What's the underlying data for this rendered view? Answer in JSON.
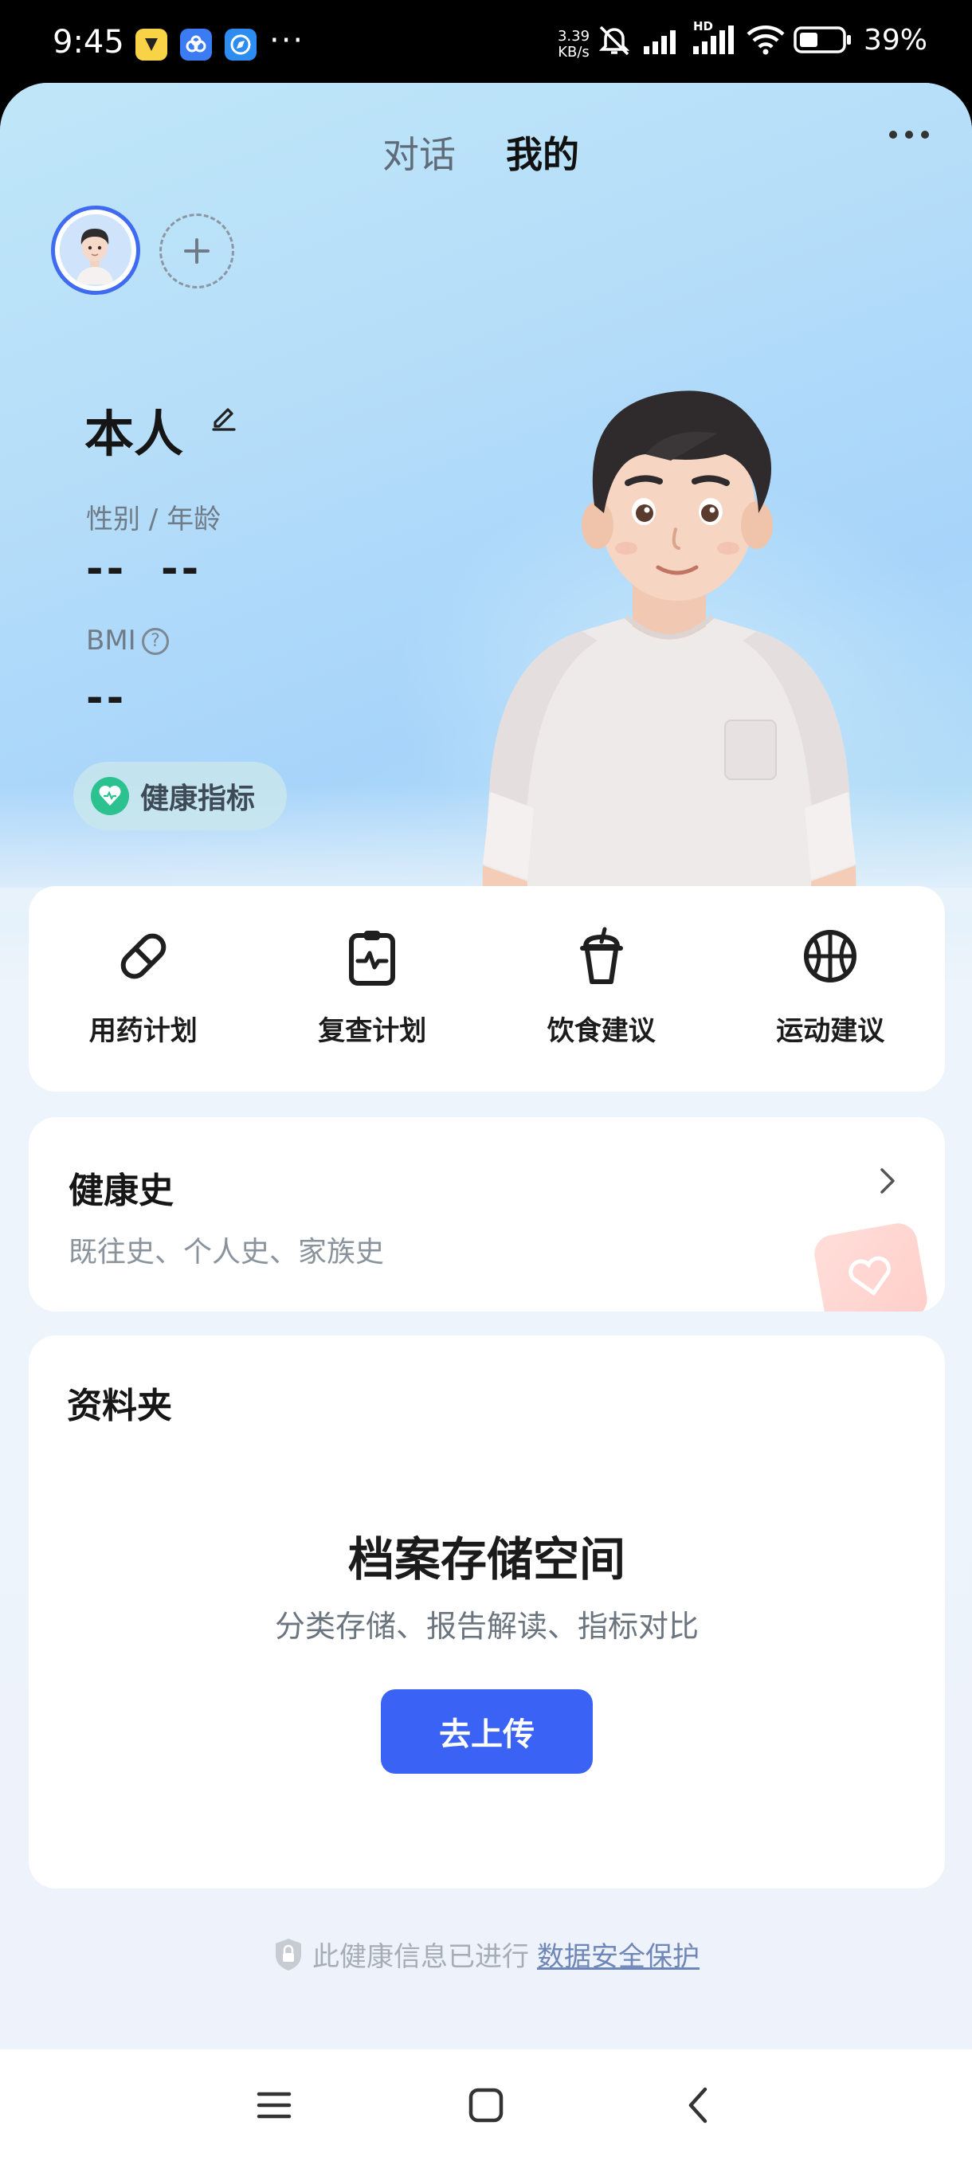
{
  "status_bar": {
    "time": "9:45",
    "net_speed_value": "3.39",
    "net_speed_unit": "KB/s",
    "hd_label": "HD",
    "battery": "39%",
    "app_icons": [
      "notes-app-icon",
      "cloud-app-icon",
      "browser-app-icon"
    ],
    "colors": {
      "notes": "#f8d247",
      "cloud": "#3b7cf5",
      "browser": "#2d8cf0"
    }
  },
  "header": {
    "tabs": [
      {
        "label": "对话",
        "active": false
      },
      {
        "label": "我的",
        "active": true
      }
    ]
  },
  "profile": {
    "name": "本人",
    "gender_age_label": "性别 / 年龄",
    "gender_value": "--",
    "age_value": "--",
    "bmi_label": "BMI",
    "bmi_help": "?",
    "bmi_value": "--",
    "health_metrics_label": "健康指标"
  },
  "quick_actions": [
    {
      "label": "用药计划",
      "icon": "pill-icon"
    },
    {
      "label": "复查计划",
      "icon": "clipboard-pulse-icon"
    },
    {
      "label": "饮食建议",
      "icon": "drink-cup-icon"
    },
    {
      "label": "运动建议",
      "icon": "basketball-icon"
    }
  ],
  "health_history": {
    "title": "健康史",
    "subtitle": "既往史、个人史、家族史"
  },
  "folder": {
    "title": "资料夹",
    "main_title": "档案存储空间",
    "subtitle": "分类存储、报告解读、指标对比",
    "upload_button": "去上传"
  },
  "footer": {
    "text": "此健康信息已进行",
    "link": "数据安全保护"
  },
  "colors": {
    "accent": "#3a63f5",
    "health_green": "#2cc28f"
  }
}
